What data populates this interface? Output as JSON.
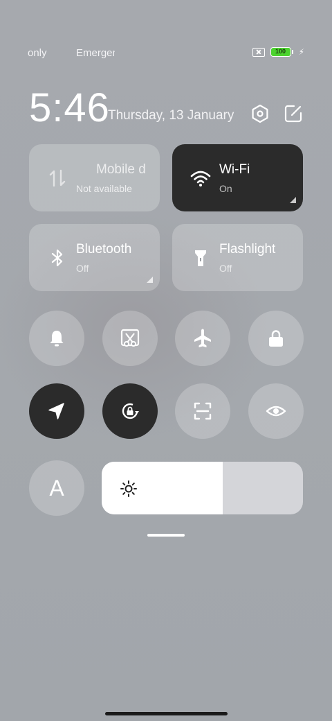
{
  "status": {
    "carrier1": "only",
    "carrier2": "Emergency",
    "battery_level": "100",
    "battery_color": "#4cd32f"
  },
  "header": {
    "time": "5:46",
    "date": "Thursday, 13 January",
    "icons": [
      "settings-icon",
      "edit-icon"
    ]
  },
  "tiles": [
    {
      "title": "Mobile data",
      "subtitle": "Not available",
      "icon": "mobile-data-icon",
      "active": false
    },
    {
      "title": "Wi-Fi",
      "subtitle": "On",
      "icon": "wifi-icon",
      "active": true
    },
    {
      "title": "Bluetooth",
      "subtitle": "Off",
      "icon": "bluetooth-icon",
      "active": false
    },
    {
      "title": "Flashlight",
      "subtitle": "Off",
      "icon": "flashlight-icon",
      "active": false
    }
  ],
  "toggles_row1": [
    "bell-icon",
    "screenshot-icon",
    "airplane-icon",
    "lock-icon"
  ],
  "toggles_row2": [
    {
      "icon": "location-icon",
      "active": true
    },
    {
      "icon": "rotation-lock-icon",
      "active": true
    },
    {
      "icon": "scan-icon",
      "active": false
    },
    {
      "icon": "eye-icon",
      "active": false
    }
  ],
  "auto_brightness_label": "A",
  "brightness": {
    "level": 0.6,
    "icon": "sun-icon"
  },
  "colors": {
    "active": "#2b2b2b",
    "accent": "#ffffff"
  }
}
